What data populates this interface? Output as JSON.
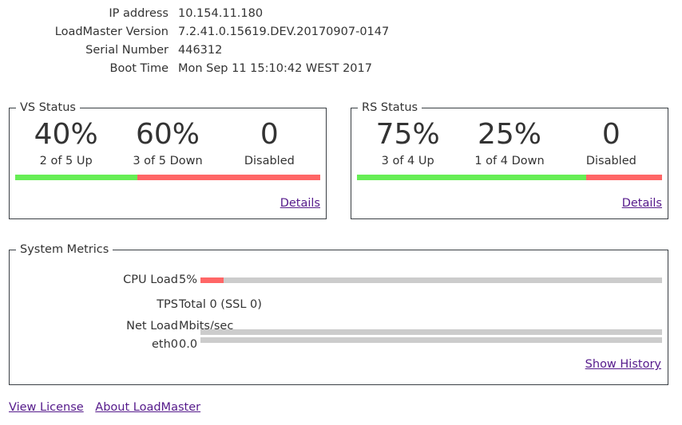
{
  "info": {
    "rows": [
      {
        "label": "IP address",
        "value": "10.154.11.180"
      },
      {
        "label": "LoadMaster Version",
        "value": "7.2.41.0.15619.DEV.20170907-0147"
      },
      {
        "label": "Serial Number",
        "value": "446312"
      },
      {
        "label": "Boot Time",
        "value": "Mon Sep 11 15:10:42 WEST 2017"
      }
    ]
  },
  "vs_status": {
    "title": "VS Status",
    "up_pct": "40%",
    "up_label": "2 of 5 Up",
    "down_pct": "60%",
    "down_label": "3 of 5 Down",
    "disabled": "0",
    "disabled_label": "Disabled",
    "up_fraction": 0.4,
    "down_fraction": 0.6,
    "details": "Details"
  },
  "rs_status": {
    "title": "RS Status",
    "up_pct": "75%",
    "up_label": "3 of 4 Up",
    "down_pct": "25%",
    "down_label": "1 of 4 Down",
    "disabled": "0",
    "disabled_label": "Disabled",
    "up_fraction": 0.75,
    "down_fraction": 0.25,
    "details": "Details"
  },
  "system_metrics": {
    "title": "System Metrics",
    "cpu_label": "CPU Load",
    "cpu_value": "5%",
    "cpu_fraction": 0.05,
    "tps_label": "TPS",
    "tps_value": "Total 0 (SSL 0)",
    "net_label": "Net Load",
    "net_unit": "Mbits/sec",
    "eth_label": "eth0",
    "eth_value": "0.0",
    "eth_fraction": 0,
    "show_history": "Show History"
  },
  "footer": {
    "view_license": "View License",
    "about": "About LoadMaster"
  },
  "colors": {
    "up": "#66ee55",
    "down": "#ff6666",
    "meter_bg": "#cccccc"
  }
}
